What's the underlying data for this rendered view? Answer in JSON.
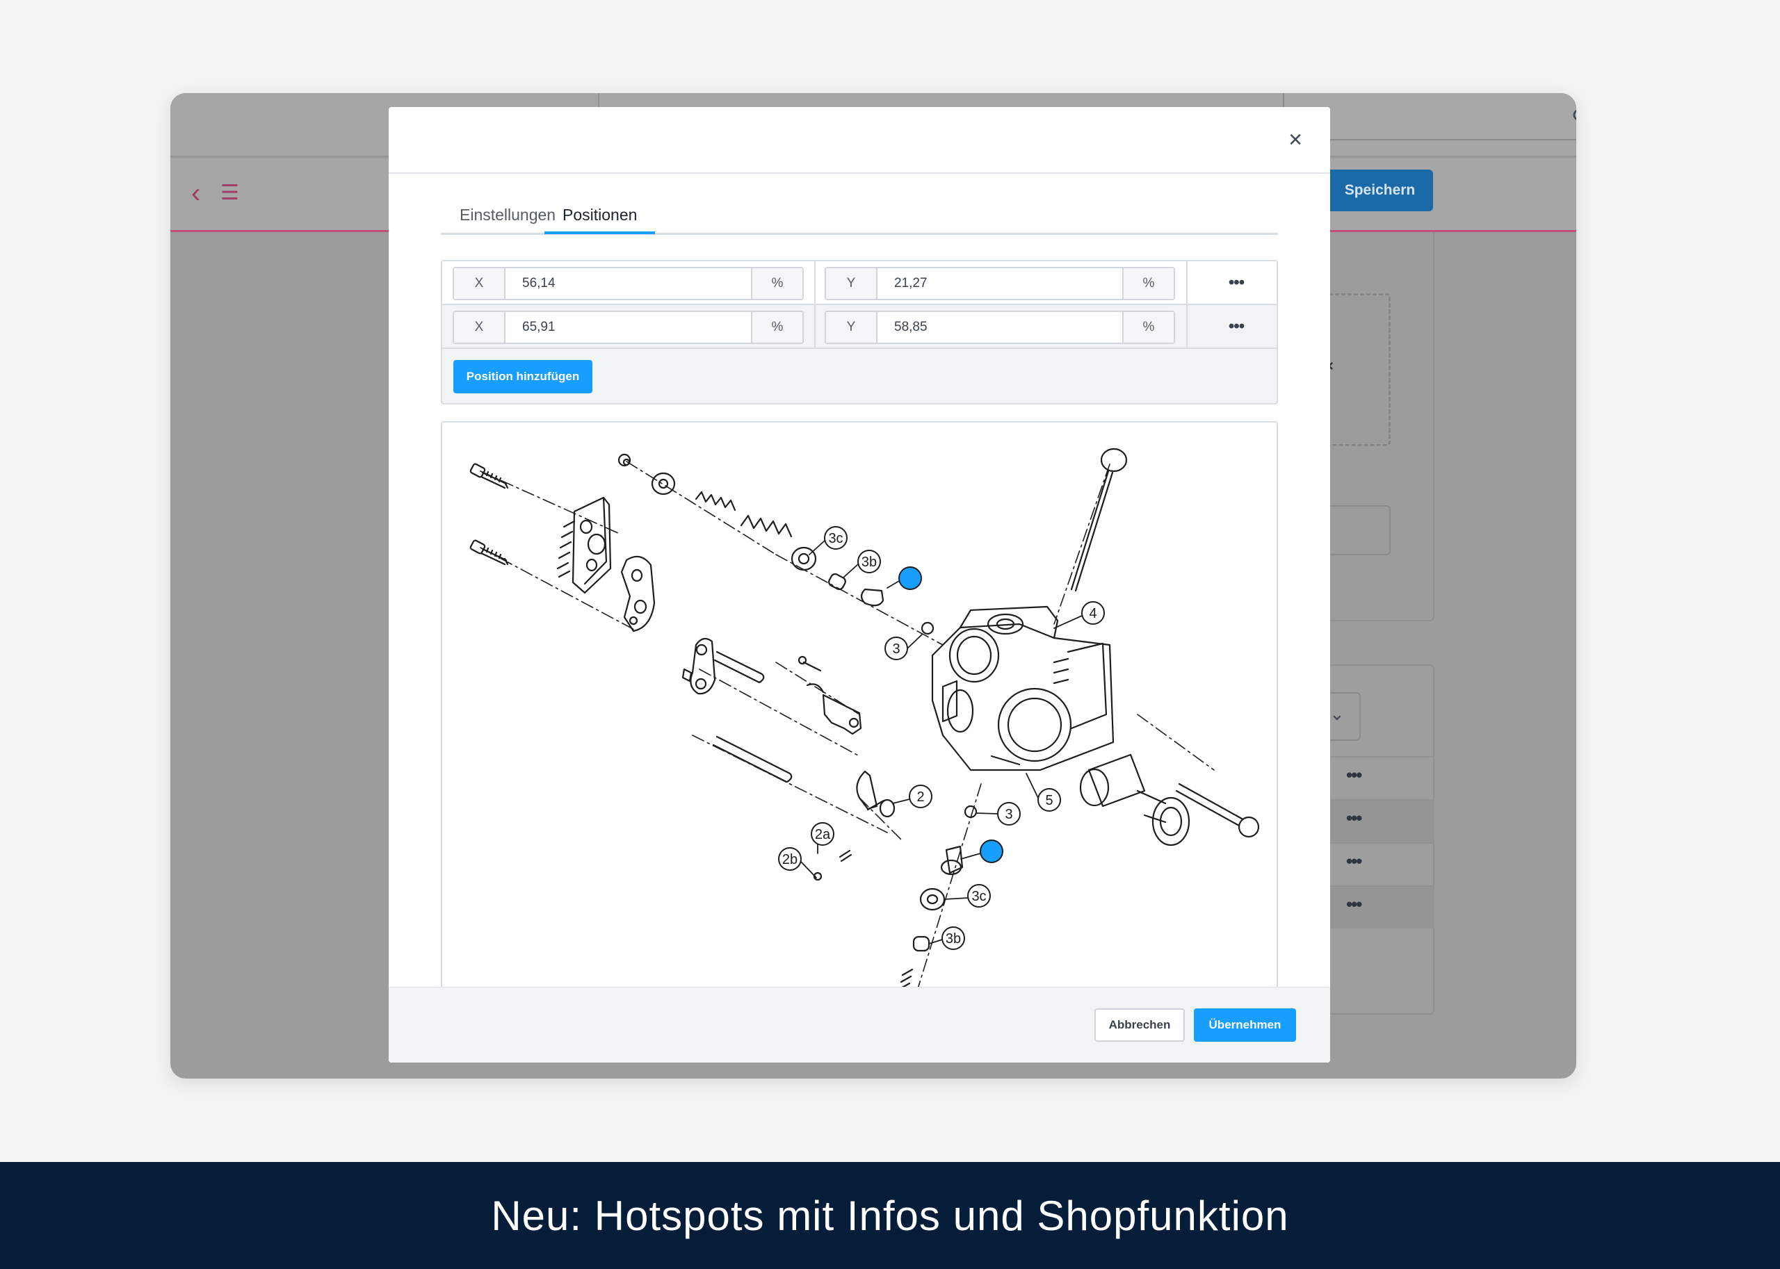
{
  "background_app": {
    "save_label": "Speichern",
    "search_icon": "search-icon",
    "back_icon": "chevron-left-icon",
    "list_icon": "list-icon",
    "row_menu_labels": [
      "•••",
      "•••",
      "•••",
      "•••"
    ],
    "accent_color": "#c2527b"
  },
  "modal": {
    "close_label": "×",
    "tabs": [
      {
        "label": "Einstellungen",
        "active": false
      },
      {
        "label": "Positionen",
        "active": true
      }
    ],
    "positions": [
      {
        "x_label": "X",
        "x_value": "56,14",
        "x_unit": "%",
        "y_label": "Y",
        "y_value": "21,27",
        "y_unit": "%",
        "menu": "•••"
      },
      {
        "x_label": "X",
        "x_value": "65,91",
        "x_unit": "%",
        "y_label": "Y",
        "y_value": "58,85",
        "y_unit": "%",
        "menu": "•••"
      }
    ],
    "add_position_label": "Position hinzufügen",
    "diagram": {
      "hotspot_color": "#189eff",
      "callouts": [
        "3c",
        "3b",
        "3",
        "4",
        "2",
        "2a",
        "2b",
        "5",
        "3",
        "3c",
        "3b"
      ]
    },
    "footer": {
      "cancel_label": "Abbrechen",
      "apply_label": "Übernehmen"
    }
  },
  "banner": {
    "text": "Neu: Hotspots mit Infos und Shopfunktion"
  }
}
